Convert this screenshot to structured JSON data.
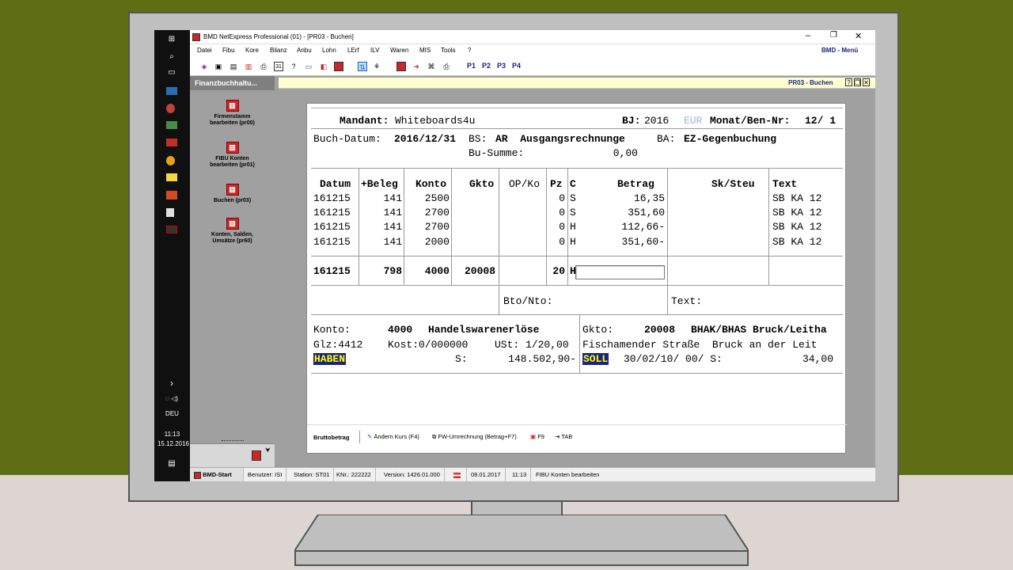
{
  "window": {
    "title": "BMD NetExpress Professional (01) - [PR03 - Buchen]",
    "menu_label": "BMD - Menü"
  },
  "menu": [
    "Datei",
    "Fibu",
    "Kore",
    "Bilanz",
    "Anbu",
    "Lohn",
    "LErf",
    "ILV",
    "Waren",
    "MIS",
    "Tools",
    "?"
  ],
  "toolbar": {
    "p_buttons": [
      "P1",
      "P2",
      "P3",
      "P4"
    ]
  },
  "sidepanel": {
    "title": "Finanzbuchhaltu...",
    "items": [
      {
        "label1": "Firmenstamm",
        "label2": "bearbeiten (pr00)"
      },
      {
        "label1": "FIBU Konten",
        "label2": "bearbeiten (pr01)"
      },
      {
        "label1": "Buchen (pr03)",
        "label2": ""
      },
      {
        "label1": "Konten, Salden,",
        "label2": "Umsätze (pr60)"
      }
    ]
  },
  "tab_title": "PR03 - Buchen",
  "taskbar": {
    "lang": "DEU",
    "time": "11:13",
    "date": "15.12.2016"
  },
  "form": {
    "mandant_label": "Mandant:",
    "mandant_value": "Whiteboards4u",
    "bj_label": "BJ:",
    "bj_value": "2016",
    "currency": "EUR",
    "monat_label": "Monat/Ben-Nr:",
    "monat_value": "12/ 1",
    "buchdatum_label": "Buch-Datum:",
    "buchdatum_value": "2016/12/31",
    "bs_label": "BS:",
    "bs_value": "AR  Ausgangsrechnunge",
    "ba_label": "BA:",
    "ba_value": "EZ-Gegenbuchung",
    "busumme_label": "Bu-Summe:",
    "busumme_value": "0,00",
    "headers": {
      "datum": "Datum",
      "beleg": "+Beleg",
      "konto": "Konto",
      "gkto": "Gkto",
      "opko": "OP/Ko",
      "pz": "Pz",
      "c": "C",
      "betrag": "Betrag",
      "sksteu": "Sk/Steu",
      "text": "Text"
    },
    "rows": [
      {
        "datum": "161215",
        "beleg": "141",
        "konto": "2500",
        "pz": "0",
        "c": "S",
        "betrag": "16,35",
        "text": "SB KA 12"
      },
      {
        "datum": "161215",
        "beleg": "141",
        "konto": "2700",
        "pz": "0",
        "c": "S",
        "betrag": "351,60",
        "text": "SB KA 12"
      },
      {
        "datum": "161215",
        "beleg": "141",
        "konto": "2700",
        "pz": "0",
        "c": "H",
        "betrag": "112,66-",
        "text": "SB KA 12"
      },
      {
        "datum": "161215",
        "beleg": "141",
        "konto": "2000",
        "pz": "0",
        "c": "H",
        "betrag": "351,60-",
        "text": "SB KA 12"
      }
    ],
    "entry": {
      "datum": "161215",
      "beleg": "798",
      "konto": "4000",
      "gkto": "20008",
      "pz": "20",
      "c": "H"
    },
    "btonto_label": "Bto/Nto:",
    "text_label": "Text:",
    "konto_label": "Konto:",
    "konto_nr": "4000",
    "konto_name": "Handelswarenerlöse",
    "glz": "Glz:4412",
    "kost": "Kost:0/000000",
    "ust": "USt: 1/20,00",
    "haben": "HABEN",
    "s_label": "S:",
    "konto_saldo": "148.502,90-",
    "gkto_label": "Gkto:",
    "gkto_nr": "20008",
    "gkto_name": "BHAK/BHAS Bruck/Leitha",
    "gkto_addr": "Fischamender Straße  Bruck an der Leit",
    "soll": "SOLL",
    "gkto_info": "30/02/10/ 00/ S:",
    "gkto_saldo": "34,00"
  },
  "bottom_actions": [
    "Bruttobetrag",
    "Ändern Kurs (F4)",
    "FW-Umrechnung (Betrag+F7)",
    "F9",
    "TAB"
  ],
  "status": {
    "start": "BMD-Start",
    "user": "Benutzer: ISI",
    "station": "Station: ST01",
    "knr": "KNr.: 222222",
    "version": "Version: 1426.01.000",
    "date": "08.01.2017",
    "time": "11:13",
    "task": "FIBU Konten bearbeiten"
  },
  "colors": {
    "wall": "#5f6d14",
    "floor": "#dcd5d1",
    "accent_navy": "#1a237e",
    "highlight_yellow": "#ffff00"
  }
}
